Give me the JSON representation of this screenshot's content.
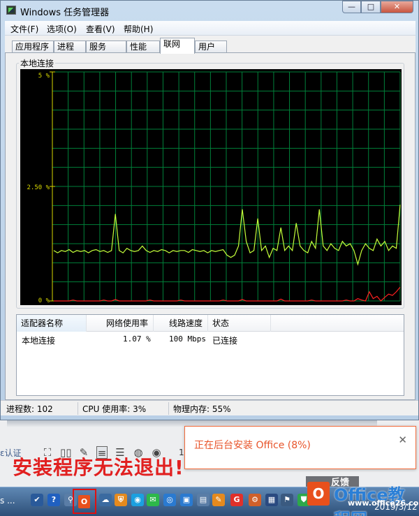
{
  "window": {
    "title": "Windows 任务管理器",
    "controls": {
      "minimize": "—",
      "maximize": "□",
      "close": "✕"
    }
  },
  "menu": [
    "文件(F)",
    "选项(O)",
    "查看(V)",
    "帮助(H)"
  ],
  "tabs": [
    {
      "label": "应用程序",
      "active": false
    },
    {
      "label": "进程",
      "active": false
    },
    {
      "label": "服务",
      "active": false
    },
    {
      "label": "性能",
      "active": false
    },
    {
      "label": "联网",
      "active": true
    },
    {
      "label": "用户",
      "active": false
    }
  ],
  "network": {
    "group_title": "本地连接",
    "y_ticks": [
      "5 %",
      "2.50 %",
      "0 %"
    ],
    "columns": [
      "适配器名称",
      "网络使用率",
      "线路速度",
      "状态"
    ],
    "rows": [
      {
        "name": "本地连接",
        "usage": "1.07 %",
        "speed": "100 Mbps",
        "status": "已连接"
      }
    ]
  },
  "chart_data": {
    "type": "line",
    "ylim": [
      0,
      5
    ],
    "y_ticks": [
      "5 %",
      "2.50 %",
      "0 %"
    ],
    "grid": true,
    "background": "#000000",
    "grid_color": "#00813a",
    "series": [
      {
        "color": "#c4ff3a",
        "values": [
          1.1,
          1.05,
          1.1,
          1.08,
          1.12,
          1.06,
          1.1,
          1.08,
          1.1,
          1.05,
          1.1,
          1.12,
          1.08,
          1.1,
          1.06,
          1.1,
          1.9,
          1.1,
          1.05,
          1.15,
          1.1,
          1.08,
          1.1,
          1.2,
          1.1,
          1.06,
          1.1,
          1.08,
          1.12,
          1.1,
          1.05,
          1.1,
          1.08,
          1.1,
          1.1,
          1.06,
          1.12,
          1.1,
          1.08,
          1.1,
          1.05,
          1.1,
          1.08,
          1.1,
          1.12,
          1.0,
          0.95,
          1.0,
          1.2,
          2.0,
          1.3,
          1.05,
          1.1,
          1.8,
          1.1,
          1.2,
          0.95,
          1.15,
          1.1,
          1.6,
          1.1,
          1.2,
          1.1,
          1.7,
          1.2,
          1.1,
          1.05,
          1.3,
          1.15,
          2.0,
          1.2,
          1.1,
          1.25,
          1.15,
          1.1,
          1.3,
          1.2,
          1.25,
          1.1,
          0.8,
          1.1,
          1.25,
          1.15,
          1.1,
          1.35,
          1.2,
          1.3,
          1.1,
          1.2,
          1.15,
          2.1
        ]
      },
      {
        "color": "#ff2020",
        "values": [
          0,
          0,
          0,
          0,
          0,
          0.02,
          0,
          0,
          0,
          0,
          0,
          0,
          0,
          0.02,
          0,
          0,
          0.03,
          0,
          0,
          0,
          0,
          0,
          0,
          0,
          0,
          0.02,
          0,
          0,
          0,
          0,
          0,
          0,
          0,
          0.02,
          0,
          0,
          0,
          0,
          0,
          0,
          0,
          0,
          0,
          0,
          0.02,
          0,
          0,
          0,
          0,
          0.03,
          0,
          0,
          0,
          0,
          0,
          0,
          0,
          0,
          0,
          0.04,
          0,
          0,
          0,
          0,
          0,
          0,
          0,
          0.02,
          0,
          0,
          0,
          0,
          0,
          0,
          0,
          0,
          0.02,
          0,
          0,
          0.05,
          0.02,
          0,
          0.2,
          0.05,
          0.1,
          0,
          0.08,
          0.15,
          0.12,
          0.2,
          0.3
        ]
      }
    ]
  },
  "statusbar": {
    "processes": "进程数: 102",
    "cpu": "CPU 使用率: 3%",
    "memory": "物理内存: 55%"
  },
  "background_app": {
    "auth_text": "ε认证",
    "partial_text": "1(",
    "warning": "安装程序无法退出!"
  },
  "toast": {
    "message": "正在后台安装 Office (8%)",
    "close": "✕"
  },
  "feedback": {
    "label": "反馈"
  },
  "taskbar": {
    "start_tail": "s ...",
    "clock_date": "2019/3/12",
    "office_icon": "O",
    "icons": [
      {
        "name": "check-icon",
        "glyph": "✔",
        "color": "#2a5a9a"
      },
      {
        "name": "help-icon",
        "glyph": "?",
        "color": "#2060c0"
      },
      {
        "name": "pin-icon",
        "glyph": "⚲",
        "color": "#5a7da6"
      },
      {
        "name": "cloud-icon",
        "glyph": "☁",
        "color": "#3a6aa0"
      },
      {
        "name": "shield-icon",
        "glyph": "⛨",
        "color": "#e58a1e"
      },
      {
        "name": "qq-icon",
        "glyph": "◉",
        "color": "#1ba0e0"
      },
      {
        "name": "wechat-icon",
        "glyph": "✉",
        "color": "#2db84a"
      },
      {
        "name": "app-icon",
        "glyph": "◎",
        "color": "#2a7ad0"
      },
      {
        "name": "monitor-icon",
        "glyph": "▣",
        "color": "#2a7ad0"
      },
      {
        "name": "folder-icon",
        "glyph": "▤",
        "color": "#5a7da6"
      },
      {
        "name": "edit-icon",
        "glyph": "✎",
        "color": "#e58a1e"
      },
      {
        "name": "weibo-icon",
        "glyph": "G",
        "color": "#e0302a"
      },
      {
        "name": "tool-icon",
        "glyph": "⚙",
        "color": "#d0602a"
      },
      {
        "name": "display-icon",
        "glyph": "▦",
        "color": "#2a4a80"
      },
      {
        "name": "flag-icon",
        "glyph": "⚑",
        "color": "#3a5a80"
      },
      {
        "name": "security-icon",
        "glyph": "⛊",
        "color": "#2da84a"
      }
    ]
  },
  "watermark": {
    "logo": "O",
    "text": "Office教程网",
    "url": "www.office26.com"
  }
}
